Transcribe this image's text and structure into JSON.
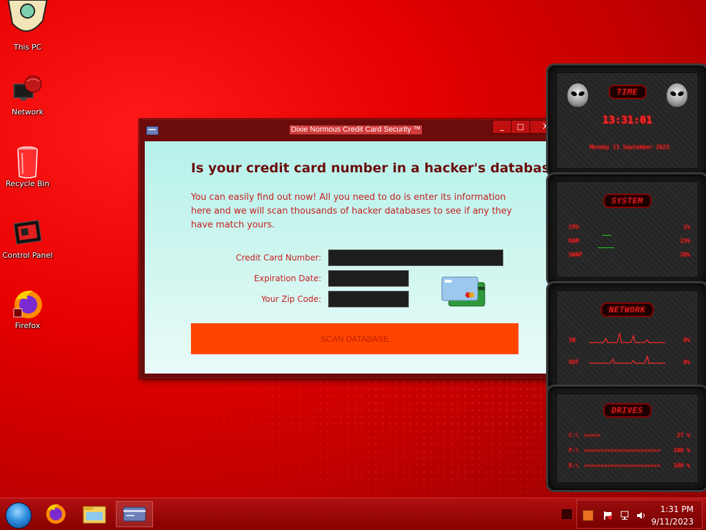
{
  "desktop": {
    "icons": [
      {
        "label": "This PC",
        "icon": "this-pc-icon"
      },
      {
        "label": "Network",
        "icon": "network-icon"
      },
      {
        "label": "Recycle Bin",
        "icon": "recycle-bin-icon"
      },
      {
        "label": "Control Panel",
        "icon": "control-panel-icon"
      },
      {
        "label": "Firefox",
        "icon": "firefox-icon"
      }
    ]
  },
  "window": {
    "title": "Dixie Normous Credit Card Security ™",
    "min_label": "_",
    "max_label": "□",
    "close_label": "X",
    "heading": "Is your credit card number in a hacker's database?",
    "description": "You can easily find out now! All you need to do is enter its information here and we will scan thousands of hacker databases to see if any they have match yours.",
    "fields": {
      "card_number_label": "Credit Card Number:",
      "card_number_value": "",
      "expiration_label": "Expiration Date:",
      "expiration_value": "",
      "zip_label": "Your Zip Code:",
      "zip_value": ""
    },
    "scan_button": "SCAN DATABASE",
    "accent_color": "#ff4400"
  },
  "gadgets": {
    "time": {
      "title": "TIME",
      "clock": "13:31:01",
      "date": "Monday 11 September 2023"
    },
    "system": {
      "title": "SYSTEM",
      "rows": [
        {
          "label": "CPU",
          "value": "1%"
        },
        {
          "label": "RAM",
          "value": "23%"
        },
        {
          "label": "SWAP",
          "value": "20%"
        }
      ]
    },
    "network": {
      "title": "NETWORK",
      "rows": [
        {
          "label": "IN",
          "value": "0%"
        },
        {
          "label": "OUT",
          "value": "0%"
        }
      ]
    },
    "drives": {
      "title": "DRIVES",
      "rows": [
        {
          "label": "C:\\",
          "bar": "»»»»»",
          "value": "27 %"
        },
        {
          "label": "F:\\",
          "bar": "»»»»»»»»»»»»»»»»»»»»»»»",
          "value": "100 %"
        },
        {
          "label": "E:\\",
          "bar": "»»»»»»»»»»»»»»»»»»»»»»»",
          "value": "100 %"
        }
      ]
    }
  },
  "taskbar": {
    "items": [
      "start-orb",
      "firefox-taskbar",
      "file-explorer-taskbar",
      "credit-card-app-taskbar"
    ],
    "clock_time": "1:31 PM",
    "clock_date": "9/11/2023"
  }
}
